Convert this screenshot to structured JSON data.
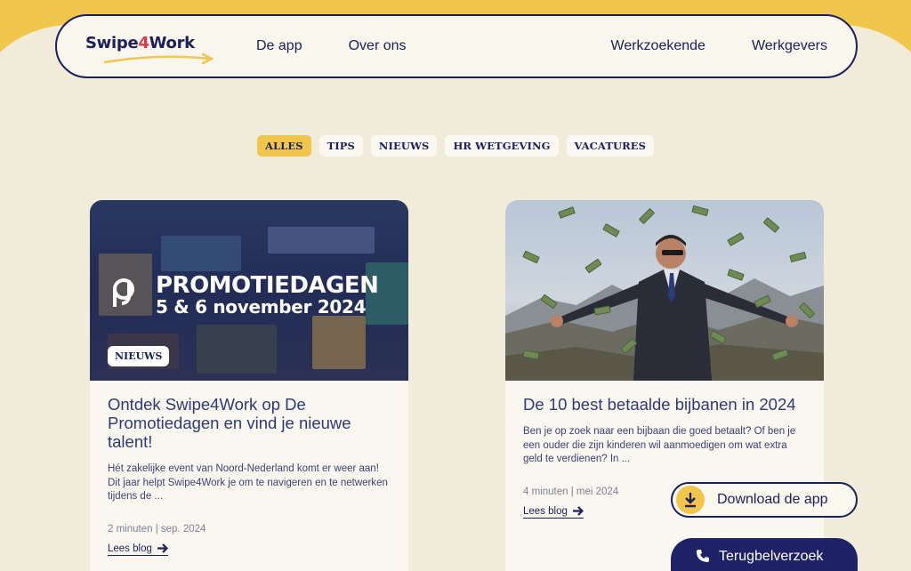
{
  "brand": {
    "name_part1": "Swipe",
    "name_part2": "4",
    "name_part3": "Work"
  },
  "nav": {
    "left": [
      "De app",
      "Over ons"
    ],
    "right": [
      "Werkzoekende",
      "Werkgevers"
    ]
  },
  "filters": [
    {
      "label": "ALLES",
      "active": true
    },
    {
      "label": "TIPS",
      "active": false
    },
    {
      "label": "NIEUWS",
      "active": false
    },
    {
      "label": "HR WETGEVING",
      "active": false
    },
    {
      "label": "VACATURES",
      "active": false
    }
  ],
  "cards": [
    {
      "badge": "NIEUWS",
      "image_title": "PROMOTIEDAGEN",
      "image_date": "5 & 6 november 2024",
      "title": "Ontdek Swipe4Work op De Promotiedagen en vind je nieuwe talent!",
      "excerpt": "Hét zakelijke event van Noord-Nederland komt er weer aan! Dit jaar helpt Swipe4Work je om te navigeren en te netwerken tijdens de ...",
      "meta": "2 minuten | sep. 2024",
      "link": "Lees blog"
    },
    {
      "title": "De 10 best betaalde bijbanen in 2024",
      "excerpt": "Ben je op zoek naar een bijbaan die goed betaalt? Of ben je een ouder die zijn kinderen wil aanmoedigen om wat extra geld te verdienen? In ...",
      "meta": "4 minuten | mei 2024",
      "link": "Lees blog"
    }
  ],
  "cta": {
    "download": "Download de app",
    "callback": "Terugbelverzoek"
  },
  "colors": {
    "accent": "#f1c64d",
    "navy": "#1b1f5c",
    "background": "#f1ecda",
    "logo_red": "#e5354a"
  }
}
